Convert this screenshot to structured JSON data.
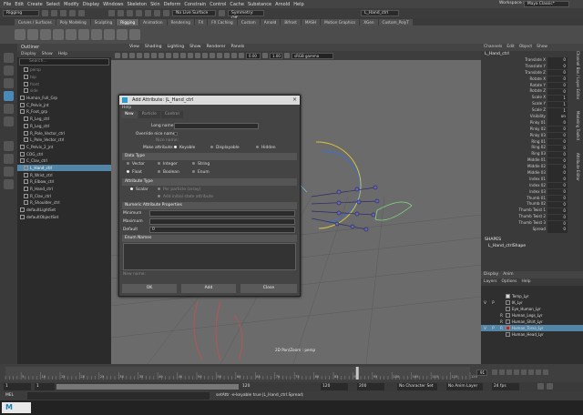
{
  "menubar": [
    "File",
    "Edit",
    "Create",
    "Select",
    "Modify",
    "Display",
    "Windows",
    "Skeleton",
    "Skin",
    "Deform",
    "Constrain",
    "Control",
    "Cache",
    "Substance",
    "Arnold",
    "Help"
  ],
  "workspace": {
    "label": "Workspace :",
    "value": "Maya Classic*"
  },
  "status": {
    "mode": "Rigging",
    "live_surface": "No Live Surface",
    "symmetry": "Symmetry: Off",
    "search_value": "L_Hand_ctrl"
  },
  "shelf_tabs": [
    "Curves / Surfaces",
    "Poly Modeling",
    "Sculpting",
    "Rigging",
    "Animation",
    "Rendering",
    "FX",
    "FX Caching",
    "Custom",
    "Arnold",
    "Bifrost",
    "MASH",
    "Motion Graphics",
    "XGen",
    "Custom_PolyT"
  ],
  "outliner": {
    "title": "Outliner",
    "menu": [
      "Display",
      "Show",
      "Help"
    ],
    "search_placeholder": "Search...",
    "items": [
      "persp",
      "top",
      "front",
      "side",
      "Human_Full_Grp",
      "C_Pelvis_jnt",
      "R_Foot_grp",
      "R_Leg_ctrl",
      "R_Leg_ctrl",
      "R_Pole_Vector_ctrl",
      "L_Pole_Vector_ctrl",
      "C_Pelvis_2_jnt",
      "COG_ctrl",
      "C_Clav_ctrl",
      "L_Hand_ctrl",
      "R_Wrist_ctrl",
      "R_Elbow_ctrl",
      "R_Hand_ctrl",
      "R_Clav_ctrl",
      "R_Shoulder_ctrl",
      "defaultLightSet",
      "defaultObjectSet"
    ],
    "selected_index": 14
  },
  "viewport": {
    "menu": [
      "View",
      "Shading",
      "Lighting",
      "Show",
      "Renderer",
      "Panels"
    ],
    "gamma": "sRGB gamma",
    "exposure": "0.00",
    "gamma_value": "1.00",
    "camera_label": "2D Pan/Zoom : persp"
  },
  "dialog": {
    "title": "Add Attribute: |L_Hand_ctrl",
    "menu": "Help",
    "tabs": [
      "New",
      "Particle",
      "Control"
    ],
    "long_name_label": "Long name:",
    "override_label": "Override nice name:",
    "nice_name_label": "Nice name:",
    "make_attr_label": "Make attribute:",
    "make_attr_options": [
      "Keyable",
      "Displayable",
      "Hidden"
    ],
    "data_type_header": "Data Type",
    "data_types": [
      "Vector",
      "Integer",
      "String",
      "Float",
      "Boolean",
      "Enum"
    ],
    "attr_type_header": "Attribute Type",
    "attr_types": [
      "Scalar",
      "Per particle (array)",
      "Add initial state attribute"
    ],
    "numeric_header": "Numeric Attribute Properties",
    "minimum_label": "Minimum",
    "maximum_label": "Maximum",
    "default_label": "Default",
    "default_value": "0",
    "enum_header": "Enum Names",
    "new_name_label": "New name:",
    "buttons": [
      "OK",
      "Add",
      "Close"
    ]
  },
  "channel_box": {
    "menu": [
      "Channels",
      "Edit",
      "Object",
      "Show"
    ],
    "node_name": "L_Hand_ctrl",
    "attributes": [
      {
        "name": "Translate X",
        "value": "0"
      },
      {
        "name": "Translate Y",
        "value": "0"
      },
      {
        "name": "Translate Z",
        "value": "0"
      },
      {
        "name": "Rotate X",
        "value": "0"
      },
      {
        "name": "Rotate Y",
        "value": "0"
      },
      {
        "name": "Rotate Z",
        "value": "0"
      },
      {
        "name": "Scale X",
        "value": "1"
      },
      {
        "name": "Scale Y",
        "value": "1"
      },
      {
        "name": "Scale Z",
        "value": "1"
      },
      {
        "name": "Visibility",
        "value": "on"
      },
      {
        "name": "Pinky 01",
        "value": "0"
      },
      {
        "name": "Pinky 02",
        "value": "0"
      },
      {
        "name": "Pinky 03",
        "value": "0"
      },
      {
        "name": "Ring 01",
        "value": "0"
      },
      {
        "name": "Ring 02",
        "value": "0"
      },
      {
        "name": "Ring 03",
        "value": "0"
      },
      {
        "name": "Middle 01",
        "value": "0"
      },
      {
        "name": "Middle 02",
        "value": "0"
      },
      {
        "name": "Middle 03",
        "value": "0"
      },
      {
        "name": "Index 01",
        "value": "0"
      },
      {
        "name": "Index 02",
        "value": "0"
      },
      {
        "name": "Index 03",
        "value": "0"
      },
      {
        "name": "Thumb 01",
        "value": "0"
      },
      {
        "name": "Thumb 02",
        "value": "0"
      },
      {
        "name": "Thumb Twist 1",
        "value": "0"
      },
      {
        "name": "Thumb Twist 2",
        "value": "0"
      },
      {
        "name": "Thumb Twist 3",
        "value": "0"
      },
      {
        "name": "Spread",
        "value": "0"
      }
    ],
    "shapes_header": "SHAPES",
    "shape_name": "L_Hand_ctrlShape",
    "side_tabs": [
      "Channel Box / Layer Editor",
      "Modeling Toolkit",
      "Attribute Editor"
    ]
  },
  "layers": {
    "tabs": [
      "Display",
      "Anim"
    ],
    "menu": [
      "Layers",
      "Options",
      "Help"
    ],
    "rows": [
      {
        "v": "",
        "p": "",
        "r": "",
        "name": "Temp_Lyr",
        "color": "#d8d8d8"
      },
      {
        "v": "V",
        "p": "P",
        "r": "",
        "name": "IK_Lyr",
        "color": "#333333"
      },
      {
        "v": "",
        "p": "",
        "r": "",
        "name": "Eye_Human_Lyr",
        "color": "#333333"
      },
      {
        "v": "",
        "p": "",
        "r": "R",
        "name": "Human_Legs_Lyr",
        "color": "#333333"
      },
      {
        "v": "",
        "p": "",
        "r": "R",
        "name": "Human_Shirt_Lyr",
        "color": "#333333"
      },
      {
        "v": "V",
        "p": "P",
        "r": "R",
        "name": "Human_Torso_Lyr",
        "color": "#d81818"
      },
      {
        "v": "",
        "p": "",
        "r": "",
        "name": "Human_Head_Lyr",
        "color": "#333333"
      }
    ],
    "selected_index": 5
  },
  "timeline": {
    "ticks": [
      "5",
      "10",
      "15",
      "20",
      "25",
      "30",
      "35",
      "40",
      "45",
      "50",
      "55",
      "60",
      "65",
      "70",
      "75",
      "80",
      "85",
      "90",
      "95",
      "100",
      "105",
      "110",
      "115",
      "120"
    ],
    "current_frame": "91",
    "start": "1",
    "start2": "1",
    "end": "120",
    "end2": "120",
    "max": "200",
    "character_set": "No Character Set",
    "anim_layer": "No Anim Layer",
    "fps": "24 fps"
  },
  "command": {
    "lang": "MEL",
    "text": "setAttr -e-keyable true |L_Hand_ctrl.Spread;"
  },
  "taskbar": {
    "label": "M"
  }
}
